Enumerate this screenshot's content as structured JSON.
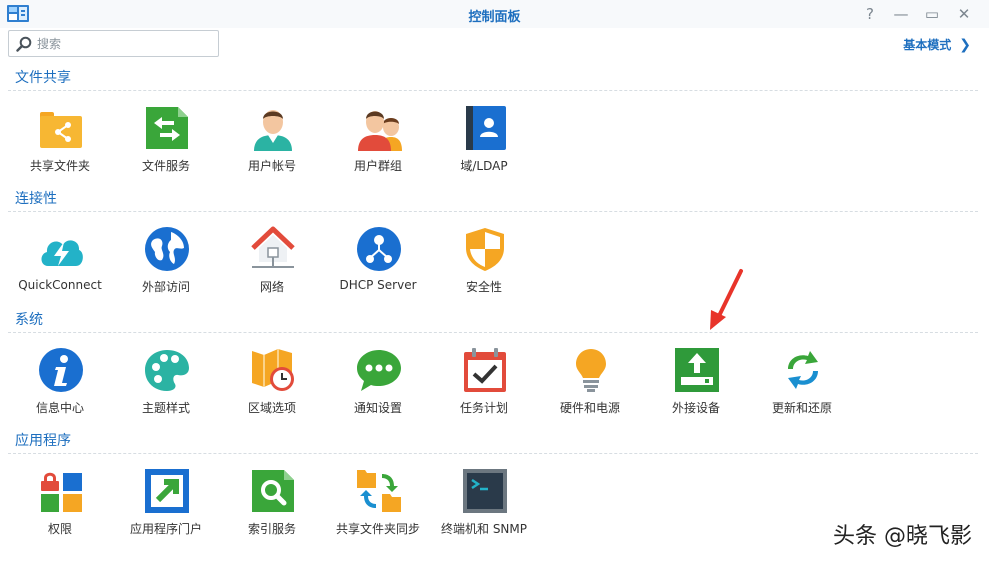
{
  "window": {
    "title": "控制面板",
    "help_glyph": "?",
    "minimize_glyph": "—",
    "maximize_glyph": "▭",
    "close_glyph": "✕"
  },
  "search": {
    "placeholder": "搜索",
    "value": ""
  },
  "mode_switch": {
    "label": "基本模式",
    "chevron": "❯"
  },
  "sections": [
    {
      "title": "文件共享",
      "items": [
        {
          "label": "共享文件夹",
          "icon": "shared-folder-icon"
        },
        {
          "label": "文件服务",
          "icon": "file-services-icon"
        },
        {
          "label": "用户帐号",
          "icon": "user-account-icon"
        },
        {
          "label": "用户群组",
          "icon": "user-group-icon"
        },
        {
          "label": "域/LDAP",
          "icon": "domain-ldap-icon"
        }
      ]
    },
    {
      "title": "连接性",
      "items": [
        {
          "label": "QuickConnect",
          "icon": "quickconnect-icon"
        },
        {
          "label": "外部访问",
          "icon": "external-access-icon"
        },
        {
          "label": "网络",
          "icon": "network-icon"
        },
        {
          "label": "DHCP Server",
          "icon": "dhcp-server-icon"
        },
        {
          "label": "安全性",
          "icon": "security-icon"
        }
      ]
    },
    {
      "title": "系统",
      "items": [
        {
          "label": "信息中心",
          "icon": "info-center-icon"
        },
        {
          "label": "主题样式",
          "icon": "theme-icon"
        },
        {
          "label": "区域选项",
          "icon": "regional-options-icon"
        },
        {
          "label": "通知设置",
          "icon": "notification-icon"
        },
        {
          "label": "任务计划",
          "icon": "task-scheduler-icon"
        },
        {
          "label": "硬件和电源",
          "icon": "hardware-power-icon"
        },
        {
          "label": "外接设备",
          "icon": "external-devices-icon"
        },
        {
          "label": "更新和还原",
          "icon": "update-restore-icon"
        }
      ]
    },
    {
      "title": "应用程序",
      "items": [
        {
          "label": "权限",
          "icon": "privileges-icon"
        },
        {
          "label": "应用程序门户",
          "icon": "application-portal-icon"
        },
        {
          "label": "索引服务",
          "icon": "indexing-service-icon"
        },
        {
          "label": "共享文件夹同步",
          "icon": "shared-folder-sync-icon"
        },
        {
          "label": "终端机和 SNMP",
          "icon": "terminal-snmp-icon"
        }
      ]
    }
  ],
  "watermark": "头条 @晓飞影",
  "colors": {
    "accent": "#1e6fbf",
    "arrow": "#e8342a"
  }
}
